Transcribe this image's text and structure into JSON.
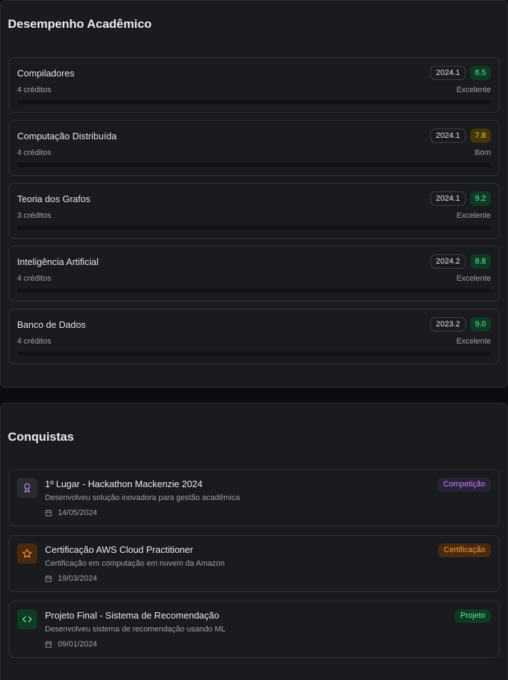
{
  "performance": {
    "title": "Desempenho Acadêmico",
    "courses": [
      {
        "name": "Compiladores",
        "credits": "4 créditos",
        "term": "2024.1",
        "grade": "8.5",
        "status": "Excelente",
        "grade_color": "green",
        "progress": 0
      },
      {
        "name": "Computação Distribuída",
        "credits": "4 créditos",
        "term": "2024.1",
        "grade": "7.8",
        "status": "Bom",
        "grade_color": "yellow",
        "progress": 0
      },
      {
        "name": "Teoria dos Grafos",
        "credits": "3 créditos",
        "term": "2024.1",
        "grade": "9.2",
        "status": "Excelente",
        "grade_color": "green",
        "progress": 0
      },
      {
        "name": "Inteligência Artificial",
        "credits": "4 créditos",
        "term": "2024.2",
        "grade": "8.8",
        "status": "Excelente",
        "grade_color": "green",
        "progress": 0
      },
      {
        "name": "Banco de Dados",
        "credits": "4 créditos",
        "term": "2023.2",
        "grade": "9.0",
        "status": "Excelente",
        "grade_color": "green",
        "progress": 0
      }
    ]
  },
  "achievements": {
    "title": "Conquistas",
    "items": [
      {
        "title": "1º Lugar - Hackathon Mackenzie 2024",
        "description": "Desenvolveu solução inovadora para gestão acadêmica",
        "date": "14/05/2024",
        "tag": "Competição",
        "icon": "award-icon",
        "tag_color": "#c084fc",
        "tag_bg": "#2a2236",
        "icon_bg": "#2a2b31",
        "icon_color": "#c084fc"
      },
      {
        "title": "Certificação AWS Cloud Practitioner",
        "description": "Certificação em computação em nuvem da Amazon",
        "date": "19/03/2024",
        "tag": "Certificação",
        "icon": "star-icon",
        "tag_color": "#fb923c",
        "tag_bg": "#4a2a0e",
        "icon_bg": "#4a2a0e",
        "icon_color": "#fb923c"
      },
      {
        "title": "Projeto Final - Sistema de Recomendação",
        "description": "Desenvolveu sistema de recomendação usando ML",
        "date": "09/01/2024",
        "tag": "Projeto",
        "icon": "code-icon",
        "tag_color": "#6ee7a1",
        "tag_bg": "#0e3b23",
        "icon_bg": "#0e3b23",
        "icon_color": "#6ee7a1"
      }
    ]
  }
}
